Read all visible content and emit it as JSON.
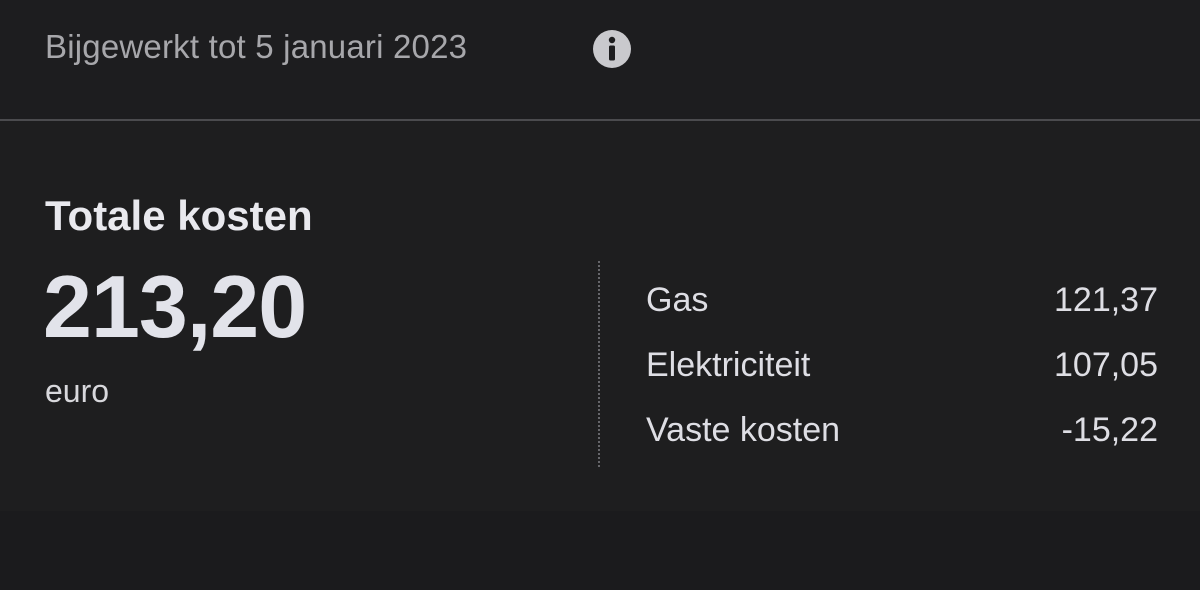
{
  "header": {
    "updated_text": "Bijgewerkt tot 5 januari 2023",
    "info_icon": "info-icon"
  },
  "summary": {
    "title": "Totale kosten",
    "value": "213,20",
    "unit": "euro"
  },
  "breakdown": [
    {
      "label": "Gas",
      "value": "121,37"
    },
    {
      "label": "Elektriciteit",
      "value": "107,05"
    },
    {
      "label": "Vaste kosten",
      "value": "-15,22"
    }
  ],
  "colors": {
    "background": "#1c1c1e",
    "divider": "#4b4b4e",
    "muted_text": "#a7a7ab",
    "primary_text": "#e6e6ea"
  }
}
